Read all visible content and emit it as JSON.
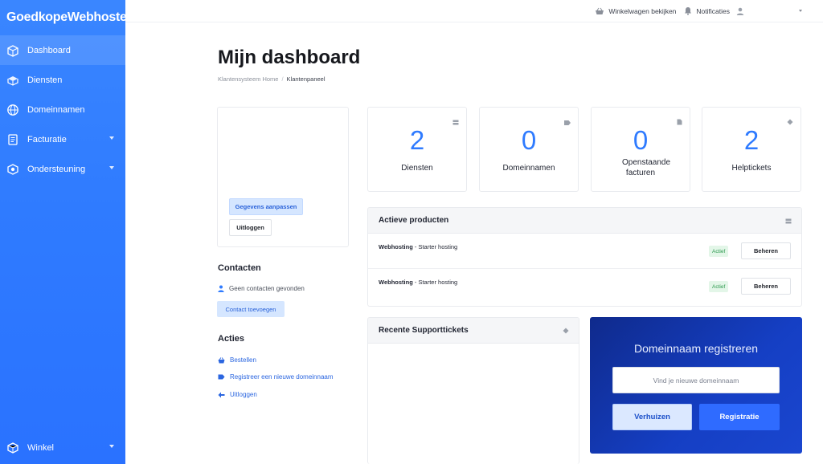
{
  "brand": {
    "logo_text": "GoedkopeWebhoster"
  },
  "sidebar": {
    "items": [
      {
        "label": "Dashboard",
        "icon": "dashboard-icon"
      },
      {
        "label": "Diensten",
        "icon": "box-icon"
      },
      {
        "label": "Domeinnamen",
        "icon": "globe-icon"
      },
      {
        "label": "Facturatie",
        "icon": "invoice-icon"
      },
      {
        "label": "Ondersteuning",
        "icon": "support-icon"
      }
    ],
    "bottom_item": {
      "label": "Winkel",
      "icon": "store-icon"
    }
  },
  "topbar": {
    "cart_label": "Winkelwagen bekijken",
    "notifications_label": "Notificaties"
  },
  "page": {
    "title": "Mijn dashboard",
    "breadcrumb": [
      "Klantensysteem Home",
      "Klantenpaneel"
    ]
  },
  "profile": {
    "edit_label": "Gegevens aanpassen",
    "logout_label": "Uitloggen"
  },
  "contacts": {
    "heading": "Contacten",
    "empty_text": "Geen contacten gevonden",
    "add_label": "Contact toevoegen"
  },
  "actions": {
    "heading": "Acties",
    "links": [
      "Bestellen",
      "Registreer een nieuwe domeinnaam",
      "Uitloggen"
    ]
  },
  "stats": [
    {
      "value": "2",
      "label": "Diensten",
      "icon": "server-icon"
    },
    {
      "value": "0",
      "label": "Domeinnamen",
      "icon": "tag-icon"
    },
    {
      "value": "0",
      "label": "Openstaande facturen",
      "icon": "document-icon"
    },
    {
      "value": "2",
      "label": "Helptickets",
      "icon": "ticket-icon"
    }
  ],
  "active_products": {
    "heading": "Actieve producten",
    "rows": [
      {
        "product": "Webhosting",
        "plan": " - Starter hosting",
        "status": "Actief",
        "action": "Beheren"
      },
      {
        "product": "Webhosting",
        "plan": " - Starter hosting",
        "status": "Actief",
        "action": "Beheren"
      }
    ]
  },
  "support_tickets": {
    "heading": "Recente Supporttickets"
  },
  "domain_register": {
    "title": "Domeinnaam registreren",
    "placeholder": "Vind je nieuwe domeinnaam",
    "transfer_label": "Verhuizen",
    "register_label": "Registratie"
  },
  "colors": {
    "accent": "#2f7bff",
    "sidebar": "#2f7bff",
    "domain_card": "#153fc4",
    "badge_green": "#2e9a50"
  }
}
